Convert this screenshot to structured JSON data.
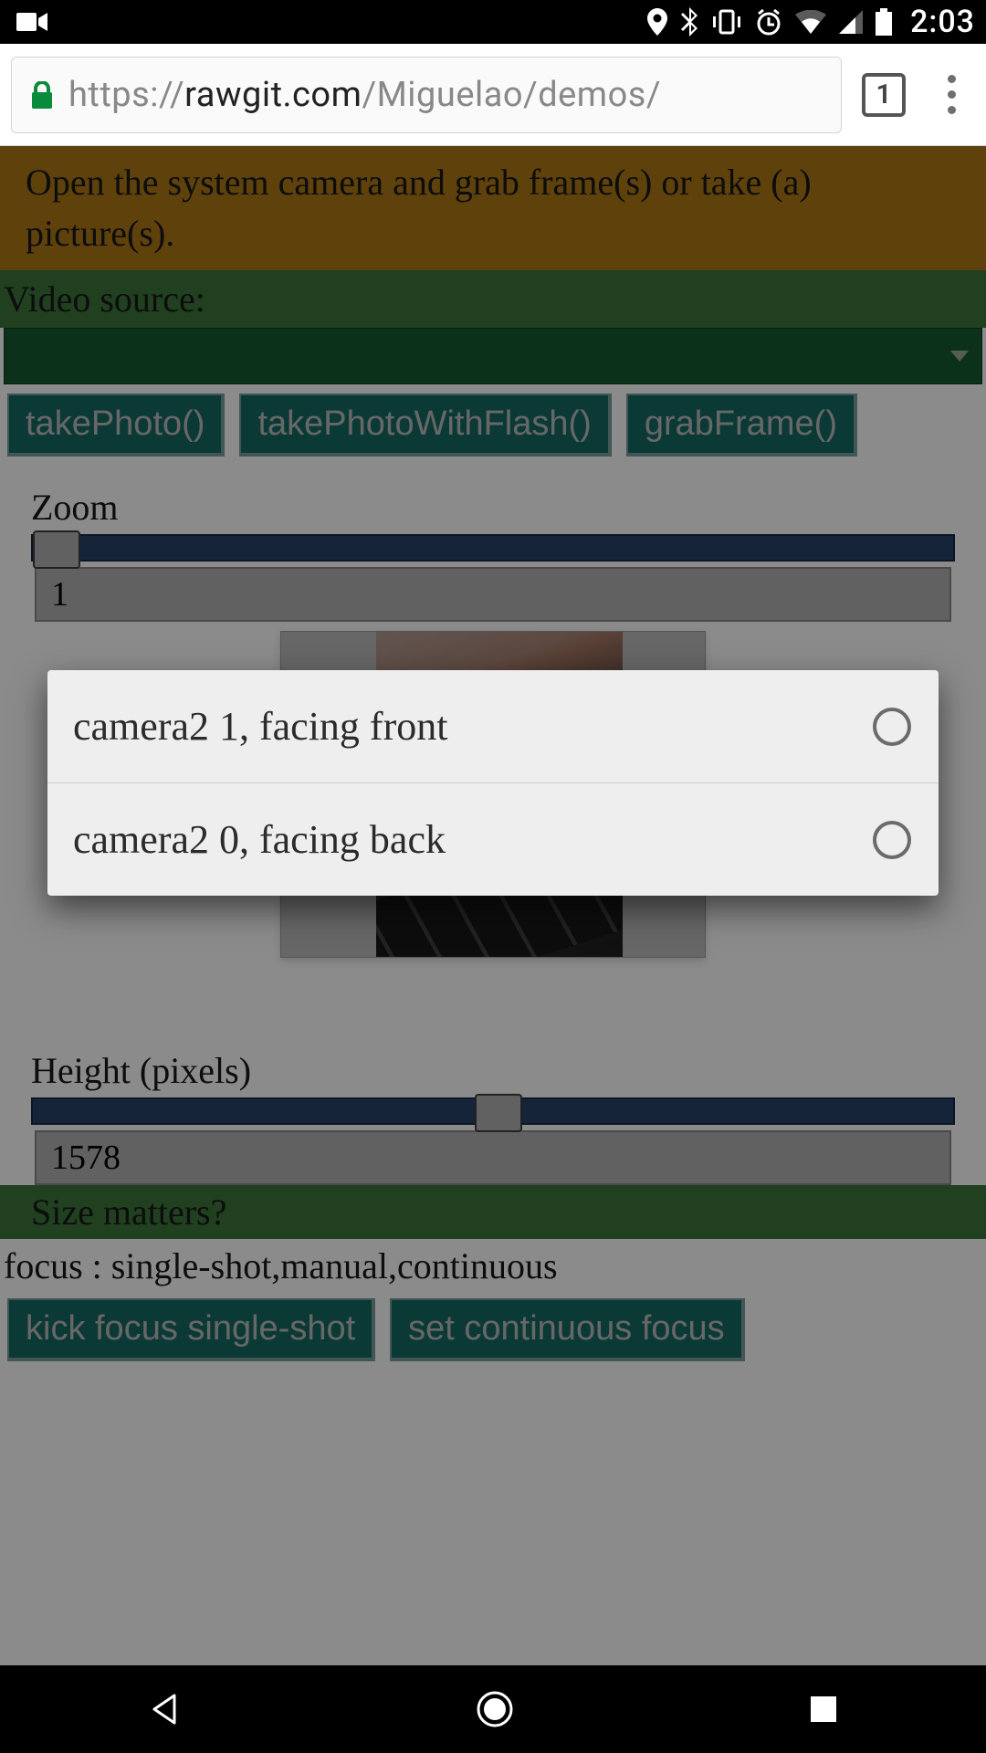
{
  "status": {
    "time": "2:03"
  },
  "browser": {
    "url_scheme": "https://",
    "url_host": "rawgit.com",
    "url_path": "/Miguelao/demos/",
    "tab_count": "1"
  },
  "page": {
    "banner": "Open the system camera and grab frame(s) or take (a) picture(s).",
    "video_source_label": "Video source:",
    "buttons": {
      "take_photo": "takePhoto()",
      "take_photo_flash": "takePhotoWithFlash()",
      "grab_frame": "grabFrame()"
    },
    "zoom": {
      "label": "Zoom",
      "value": "1",
      "thumb_pct": 0
    },
    "height": {
      "label": "Height (pixels)",
      "value": "1578",
      "thumb_pct": 48
    },
    "size_matters": "Size matters?",
    "focus_line": "focus : single-shot,manual,continuous",
    "focus_buttons": {
      "kick": "kick focus single-shot",
      "continuous": "set continuous focus"
    }
  },
  "popup": {
    "options": [
      {
        "label": "camera2 1, facing front"
      },
      {
        "label": "camera2 0, facing back"
      }
    ]
  }
}
